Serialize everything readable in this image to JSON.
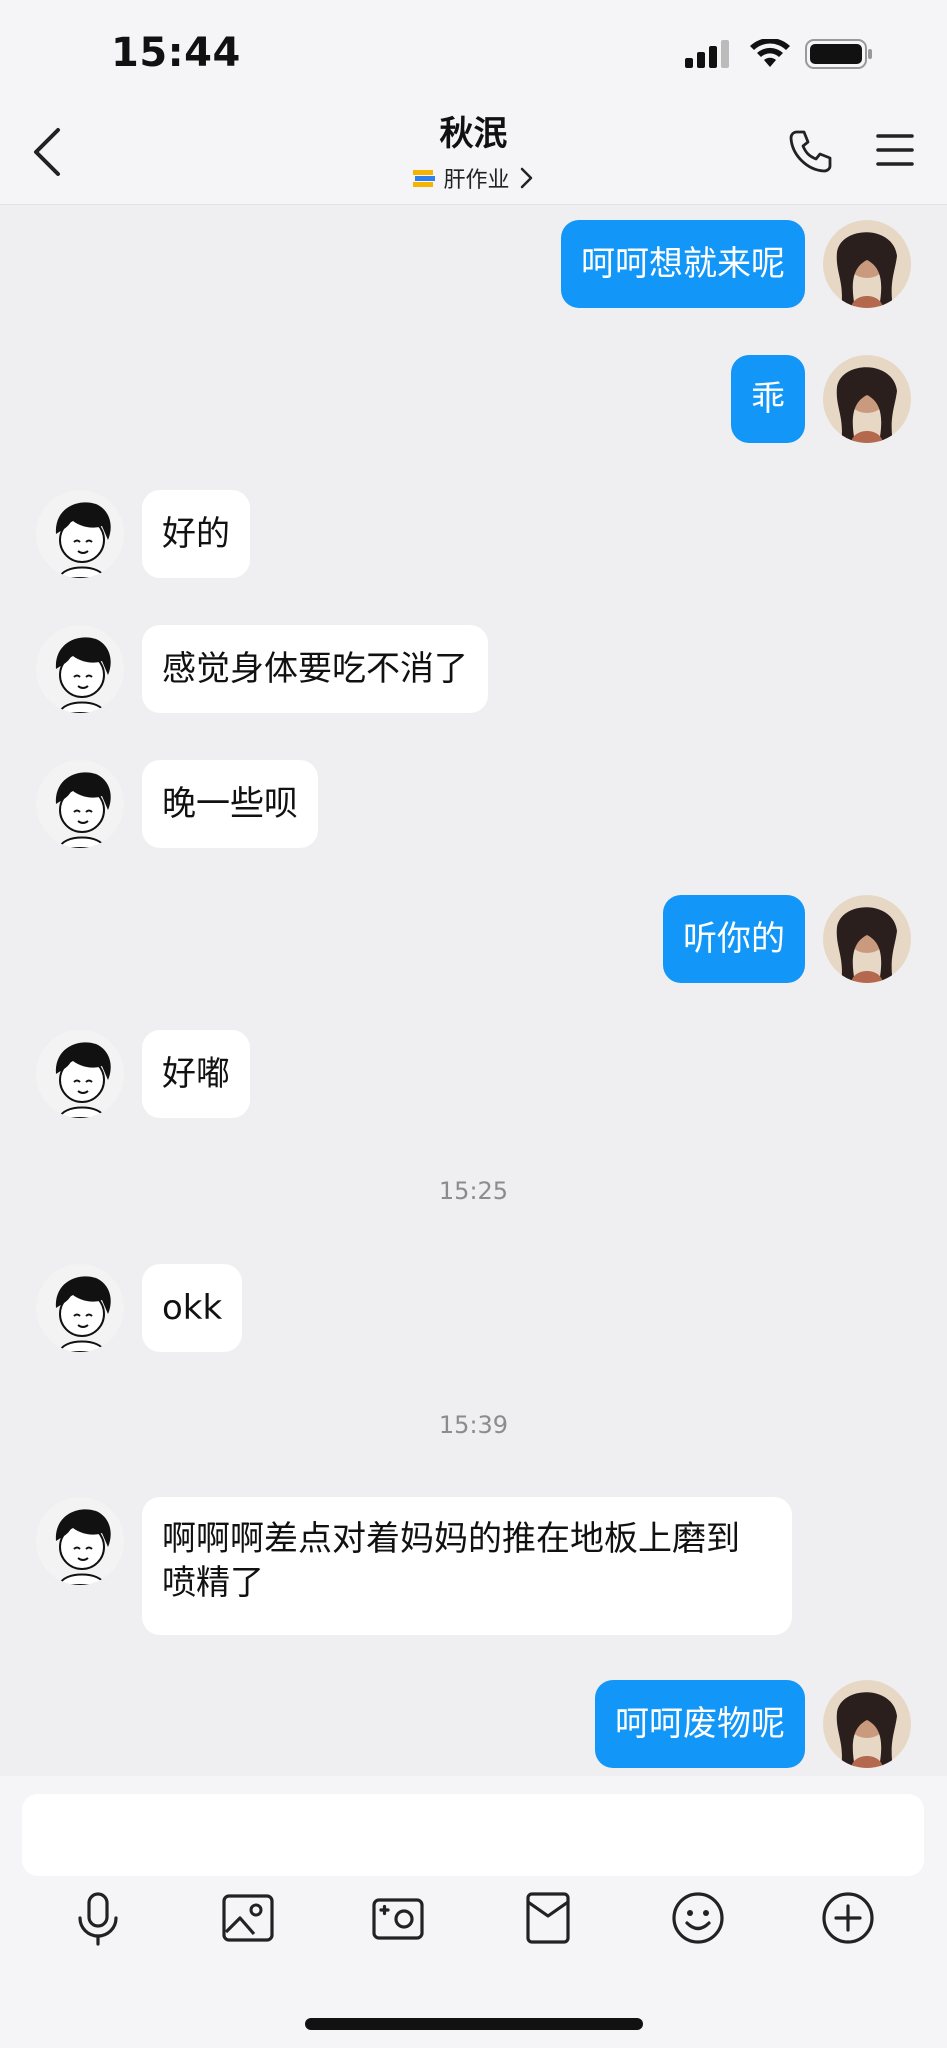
{
  "status_bar": {
    "time": "15:44"
  },
  "header": {
    "title": "秋泯",
    "subtitle": "肝作业"
  },
  "messages": [
    {
      "side": "out",
      "text": "呵呵想就来呢"
    },
    {
      "side": "out",
      "text": "乖"
    },
    {
      "side": "in",
      "text": "好的"
    },
    {
      "side": "in",
      "text": "感觉身体要吃不消了"
    },
    {
      "side": "in",
      "text": "晚一些呗"
    },
    {
      "side": "out",
      "text": "听你的"
    },
    {
      "side": "in",
      "text": "好嘟"
    },
    {
      "side": "in",
      "text": "okk"
    },
    {
      "side": "in",
      "text": "啊啊啊差点对着妈妈的推在地板上磨到喷精了"
    },
    {
      "side": "out",
      "text": "呵呵废物呢"
    }
  ],
  "timestamps": [
    "15:25",
    "15:39"
  ],
  "input": {
    "value": "",
    "placeholder": ""
  },
  "toolbar": {
    "items": [
      "microphone-icon",
      "image-icon",
      "camera-icon",
      "red-packet-icon",
      "emoji-icon",
      "plus-icon"
    ]
  },
  "colors": {
    "outgoing_bubble": "#1296f7",
    "incoming_bubble": "#ffffff",
    "background": "#efeff1"
  }
}
